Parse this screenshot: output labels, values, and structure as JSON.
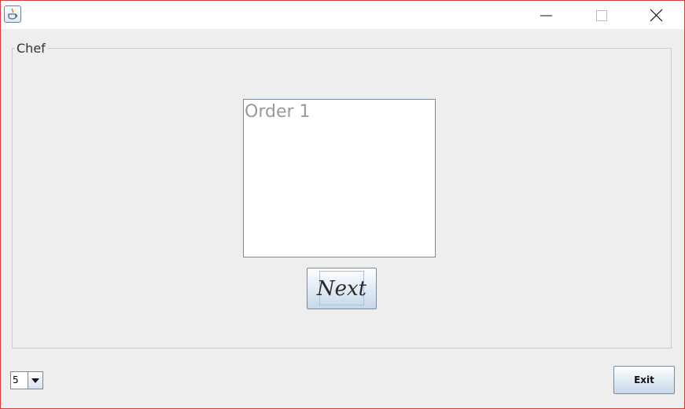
{
  "titlebar": {
    "app_icon": "java-coffee-cup-icon",
    "controls": [
      "minimize-icon",
      "maximize-icon",
      "close-icon"
    ]
  },
  "chef_panel": {
    "title": "Chef",
    "order_text": "Order 1",
    "next_label": "Next"
  },
  "footer": {
    "count_value": "5",
    "exit_label": "Exit"
  },
  "colors": {
    "window_border": "#d23f3f",
    "panel_border": "#b8cfe5",
    "button_gradient_end": "#c7d7e8",
    "background": "#eeeeee"
  }
}
